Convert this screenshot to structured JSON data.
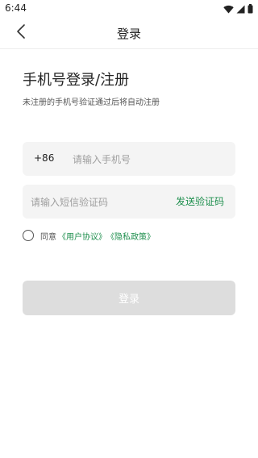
{
  "status_bar": {
    "time": "6:44"
  },
  "header": {
    "back_icon": "chevron-left-icon",
    "title": "登录"
  },
  "main": {
    "title": "手机号登录/注册",
    "subtitle": "未注册的手机号验证通过后将自动注册",
    "phone": {
      "country_code": "+86",
      "placeholder": "请输入手机号"
    },
    "code": {
      "placeholder": "请输入短信验证码",
      "send_label": "发送验证码"
    },
    "agreement": {
      "prefix": "同意",
      "user_agreement": "《用户协议》",
      "privacy_policy": "《隐私政策》",
      "checked": false
    },
    "login_label": "登录"
  },
  "colors": {
    "accent": "#1f8f4e",
    "field_bg": "#f4f4f4",
    "button_disabled": "#dddddd"
  }
}
